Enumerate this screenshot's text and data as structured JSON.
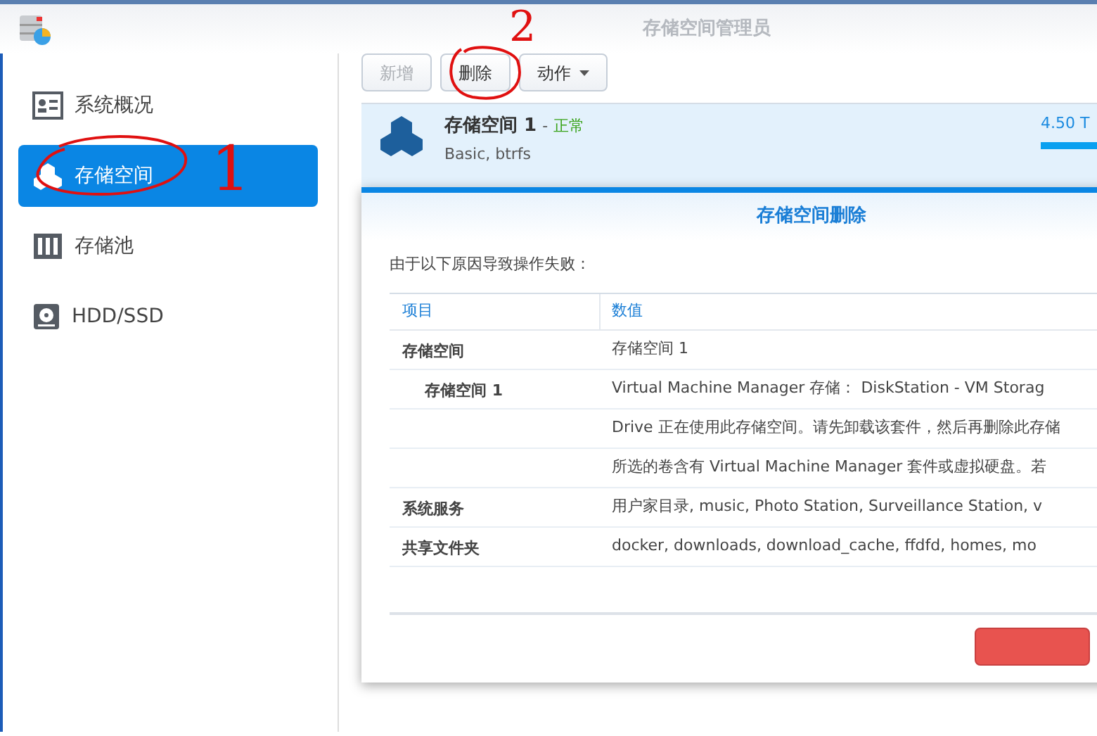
{
  "window": {
    "title": "存储空间管理员"
  },
  "sidebar": {
    "items": [
      {
        "label": "系统概况",
        "kind": "overview",
        "selected": false
      },
      {
        "label": "存储空间",
        "kind": "volume",
        "selected": true
      },
      {
        "label": "存储池",
        "kind": "pool",
        "selected": false
      },
      {
        "label": "HDD/SSD",
        "kind": "disk",
        "selected": false
      }
    ]
  },
  "toolbar": [
    {
      "label": "新增",
      "disabled": true,
      "dropdown": false
    },
    {
      "label": "删除",
      "disabled": false,
      "dropdown": false
    },
    {
      "label": "动作",
      "disabled": false,
      "dropdown": true
    }
  ],
  "volume": {
    "name": "存储空间 1",
    "separator": "-",
    "status": "正常",
    "detail": "Basic, btrfs",
    "capacity": "4.50 T",
    "level": 1
  },
  "dialog": {
    "title": "存储空间删除",
    "message": "由于以下原因导致操作失败：",
    "columns": [
      "项目",
      "数值"
    ],
    "rows": [
      {
        "item": "存储空间",
        "values": [
          "存储空间 1"
        ],
        "children": [
          {
            "item": "存储空间 1",
            "values": [
              "Virtual Machine Manager 存储： DiskStation - VM Storag",
              "Drive 正在使用此存储空间。请先卸载该套件，然后再删除此存储",
              "所选的卷含有 Virtual Machine Manager 套件或虚拟硬盘。若"
            ]
          }
        ]
      },
      {
        "item": "系统服务",
        "values": [
          "用户家目录, music, Photo Station, Surveillance Station, v"
        ]
      },
      {
        "item": "共享文件夹",
        "values": [
          "docker, downloads, download_cache, ffdfd, homes, mo"
        ]
      }
    ]
  },
  "annotations": [
    {
      "text": "1"
    },
    {
      "text": "2"
    }
  ]
}
